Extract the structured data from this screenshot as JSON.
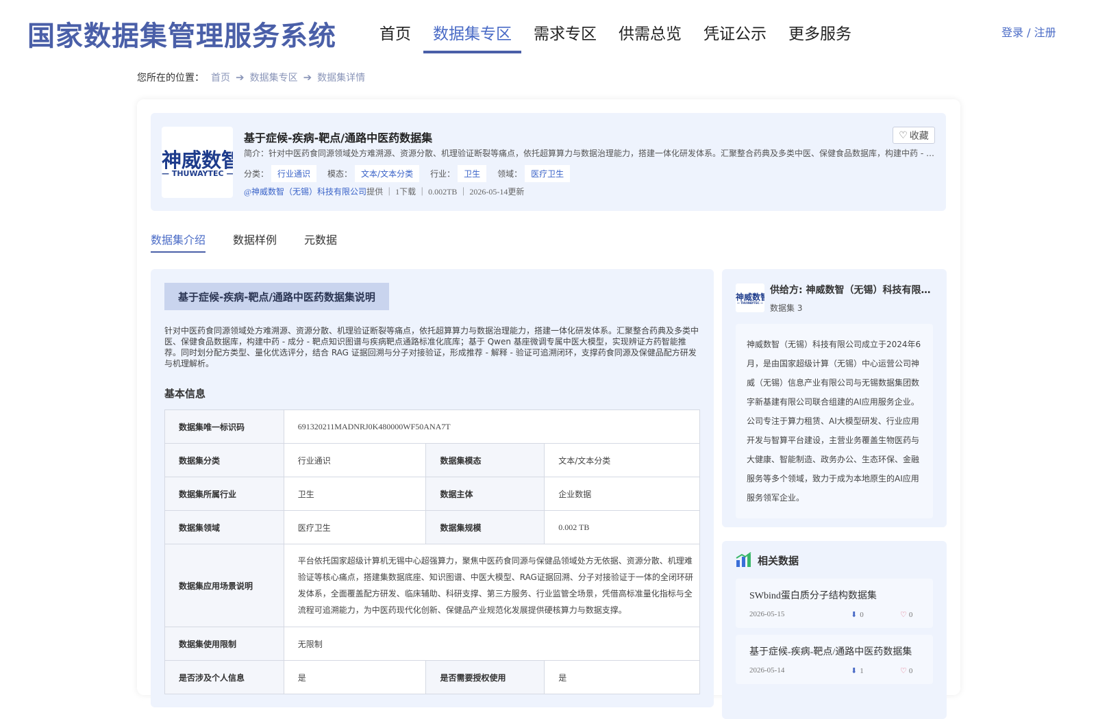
{
  "header": {
    "brand": "国家数据集管理服务系统",
    "nav": [
      "首页",
      "数据集专区",
      "需求专区",
      "供需总览",
      "凭证公示",
      "更多服务"
    ],
    "active_nav": 1,
    "login": "登录 / 注册"
  },
  "breadcrumb": {
    "prefix": "您所在的位置：",
    "items": [
      "首页",
      "数据集专区",
      "数据集详情"
    ]
  },
  "dataset": {
    "logo_cn": "神威数智",
    "logo_en": "— THUWAYTEC —",
    "title": "基于症候-疾病-靶点/通路中医药数据集",
    "favorite_label": "收藏",
    "intro": "简介：针对中医药食同源领域处方难溯源、资源分散、机理验证断裂等痛点，依托超算算力与数据治理能力，搭建一体化研发体系。汇聚整合药典及多类中医、保健食品数据库，构建中药 - 成分 - 靶点知识图谱与疾病靶点通路标准化底库",
    "tags": [
      {
        "label": "分类：",
        "value": "行业通识"
      },
      {
        "label": "模态：",
        "value": "文本/文本分类"
      },
      {
        "label": "行业：",
        "value": "卫生"
      },
      {
        "label": "领域：",
        "value": "医疗卫生"
      }
    ],
    "provider": "@神威数智（无锡）科技有限公司",
    "meta": "提供 ｜ 1下载 ｜ 0.002TB ｜ 2026-05-14更新"
  },
  "tabs": [
    "数据集介绍",
    "数据样例",
    "元数据"
  ],
  "active_tab": 0,
  "description": {
    "heading": "基于症候-疾病-靶点/通路中医药数据集说明",
    "text": "针对中医药食同源领域处方难溯源、资源分散、机理验证断裂等痛点，依托超算算力与数据治理能力，搭建一体化研发体系。汇聚整合药典及多类中医、保健食品数据库，构建中药 - 成分 - 靶点知识图谱与疾病靶点通路标准化底库；基于 Qwen 基座微调专属中医大模型，实现辨证方药智能推荐。同时划分配方类型、量化优选评分，结合 RAG 证据回溯与分子对接验证，形成推荐 - 解释 - 验证可追溯闭环，支撑药食同源及保健品配方研发与机理解析。"
  },
  "basic_info": {
    "title": "基本信息",
    "id_label": "数据集唯一标识码",
    "id_value": "691320211MADNRJ0K480000WF50ANA7T",
    "category_label": "数据集分类",
    "category_value": "行业通识",
    "modality_label": "数据集模态",
    "modality_value": "文本/文本分类",
    "industry_label": "数据集所属行业",
    "industry_value": "卫生",
    "subject_label": "数据主体",
    "subject_value": "企业数据",
    "domain_label": "数据集领域",
    "domain_value": "医疗卫生",
    "scale_label": "数据集规模",
    "scale_value": "0.002 TB",
    "scenario_label": "数据集应用场景说明",
    "scenario_value": "平台依托国家超级计算机无锡中心超强算力，聚焦中医药食同源与保健品领域处方无依据、资源分散、机理难验证等核心痛点，搭建集数据底座、知识图谱、中医大模型、RAG证据回溯、分子对接验证于一体的全闭环研发体系，全面覆盖配方研发、临床辅助、科研支撑、第三方服务、行业监管全场景，凭借高标准量化指标与全流程可追溯能力，为中医药现代化创新、保健品产业规范化发展提供硬核算力与数据支撑。",
    "limit_label": "数据集使用限制",
    "limit_value": "无限制",
    "personal_label": "是否涉及个人信息",
    "personal_value": "是",
    "auth_label": "是否需要授权使用",
    "auth_value": "是"
  },
  "supplier": {
    "name": "供给方: 神威数智（无锡）科技有限公司",
    "count": "数据集 3",
    "logo_cn": "神威数智",
    "logo_en": "— THUWAYTEC —",
    "description": "神威数智（无锡）科技有限公司成立于2024年6月，是由国家超级计算（无锡）中心运营公司神威（无锡）信息产业有限公司与无锡数据集团数字新基建有限公司联合组建的AI应用服务企业。公司专注于算力租赁、AI大模型研发、行业应用开发与智算平台建设，主营业务覆盖生物医药与大健康、智能制造、政务办公、生态环保、金融服务等多个领域，致力于成为本地原生的AI应用服务领军企业。"
  },
  "related": {
    "title": "相关数据",
    "items": [
      {
        "name": "SWbind蛋白质分子结构数据集",
        "date": "2026-05-15",
        "downloads": "0",
        "likes": "0"
      },
      {
        "name": "基于症候-疾病-靶点/通路中医药数据集",
        "date": "2026-05-14",
        "downloads": "1",
        "likes": "0"
      }
    ]
  },
  "colors": {
    "brand": "#4a5fa8",
    "accent": "#4a6bc6",
    "panel_bg": "#eef3fd"
  }
}
